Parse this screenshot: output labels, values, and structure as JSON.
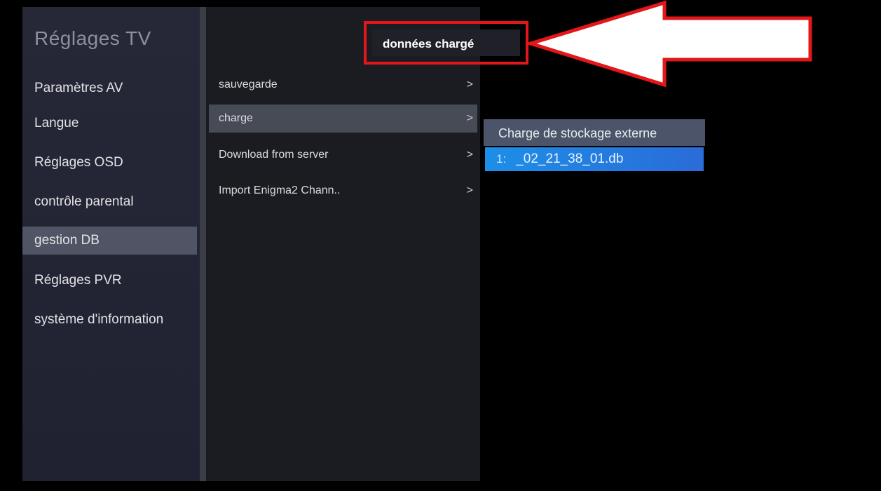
{
  "sidebar": {
    "title": "Réglages TV",
    "items": [
      {
        "label": "Paramètres AV"
      },
      {
        "label": "Langue"
      },
      {
        "label": "Réglages OSD"
      },
      {
        "label": "contrôle parental"
      },
      {
        "label": "gestion DB"
      },
      {
        "label": "Réglages PVR"
      },
      {
        "label": "système d'information"
      }
    ],
    "active_index": 4
  },
  "submenu": {
    "items": [
      {
        "label": "sauvegarde",
        "chevron": ">"
      },
      {
        "label": "charge",
        "chevron": ">"
      },
      {
        "label": "Download from server",
        "chevron": ">"
      },
      {
        "label": "Import Enigma2 Chann..",
        "chevron": ">"
      }
    ],
    "active_index": 1
  },
  "popup": {
    "title": "Charge de stockage externe",
    "selected_row": {
      "index": "1:",
      "filename": "_02_21_38_01.db"
    }
  },
  "annotation": {
    "text": "données chargé",
    "color": "#e3161a"
  }
}
